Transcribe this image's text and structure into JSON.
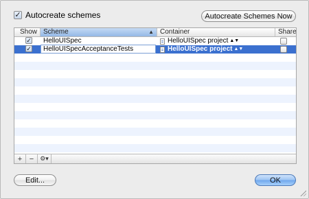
{
  "top": {
    "autocreate_label": "Autocreate schemes",
    "autocreate_checked": true,
    "autocreate_now_label": "Autocreate Schemes Now"
  },
  "table": {
    "columns": {
      "show": "Show",
      "scheme": "Scheme",
      "container": "Container",
      "shared": "Shared"
    },
    "sort_indicator": "▲",
    "rows": [
      {
        "show": true,
        "scheme": "HelloUISpec",
        "container": "HelloUISpec project",
        "shared": false,
        "selected": false
      },
      {
        "show": true,
        "scheme": "HelloUISpecAcceptanceTests",
        "container": "HelloUISpec project",
        "shared": false,
        "selected": true
      }
    ],
    "toolbar": {
      "add": "+",
      "remove": "−",
      "gear": "⚙▾"
    }
  },
  "footer": {
    "edit_label": "Edit...",
    "ok_label": "OK"
  },
  "colors": {
    "selection": "#3b70cf",
    "stripe": "#edf3fe",
    "default_button": "#6ea6ec"
  }
}
